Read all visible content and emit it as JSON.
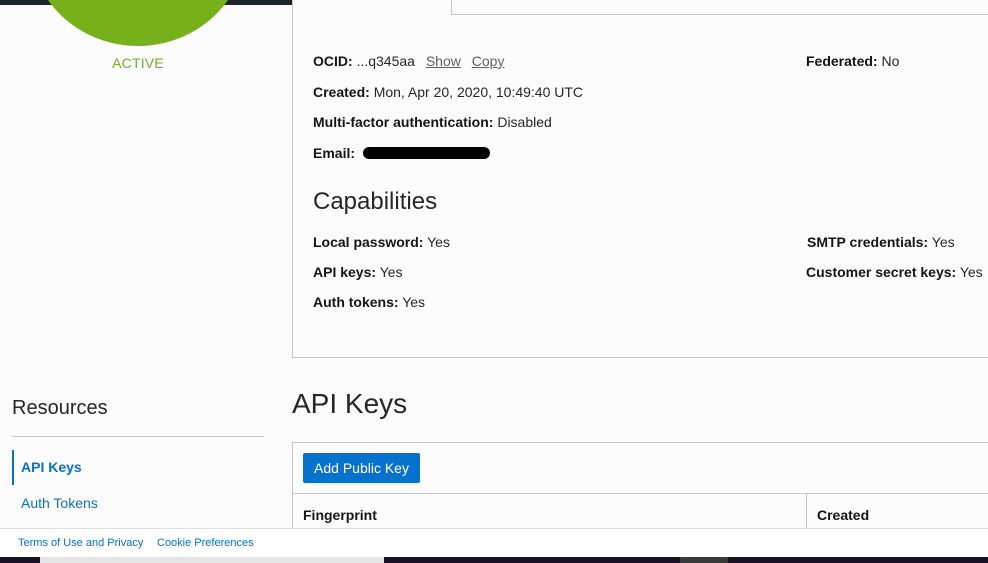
{
  "user": {
    "status": "ACTIVE",
    "ocid_label": "OCID:",
    "ocid_value": "...q345aa",
    "show_label": "Show",
    "copy_label": "Copy",
    "federated_label": "Federated:",
    "federated_value": "No",
    "created_label": "Created:",
    "created_value": "Mon, Apr 20, 2020, 10:49:40 UTC",
    "mfa_label": "Multi-factor authentication:",
    "mfa_value": "Disabled",
    "email_label": "Email:"
  },
  "capabilities": {
    "title": "Capabilities",
    "local_password_label": "Local password:",
    "local_password_value": "Yes",
    "smtp_label": "SMTP credentials:",
    "smtp_value": "Yes",
    "api_keys_label": "API keys:",
    "api_keys_value": "Yes",
    "customer_secret_label": "Customer secret keys:",
    "customer_secret_value": "Yes",
    "auth_tokens_label": "Auth tokens:",
    "auth_tokens_value": "Yes"
  },
  "resources": {
    "title": "Resources",
    "items": [
      {
        "label": "API Keys"
      },
      {
        "label": "Auth Tokens"
      }
    ]
  },
  "api_keys": {
    "title": "API Keys",
    "add_button": "Add Public Key",
    "columns": [
      "Fingerprint",
      "Created"
    ]
  },
  "footer": {
    "terms": "Terms of Use and Privacy",
    "cookies": "Cookie Preferences"
  },
  "colors": {
    "accent": "#0572ce",
    "status_active": "#76b11c"
  }
}
